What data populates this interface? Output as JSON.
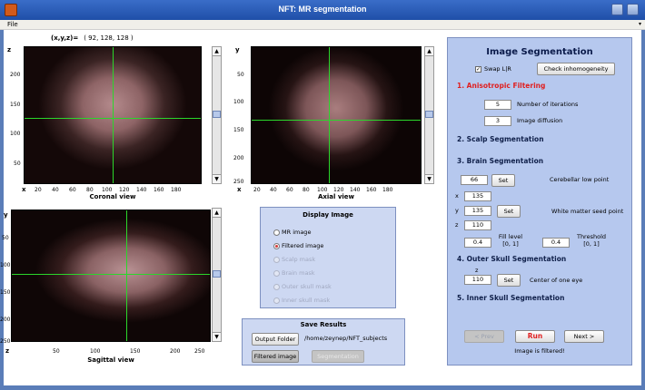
{
  "window": {
    "title": "NFT: MR segmentation"
  },
  "menu": {
    "file": "File"
  },
  "coords": {
    "label": "(x,y,z)=",
    "value": "( 92, 128, 128 )"
  },
  "coronal": {
    "xlabel": "x",
    "ylabel": "z",
    "title": "Coronal view",
    "xticks": [
      "20",
      "40",
      "60",
      "80",
      "100",
      "120",
      "140",
      "160",
      "180"
    ],
    "yticks": [
      "200",
      "150",
      "100",
      "50"
    ]
  },
  "axial": {
    "xlabel": "x",
    "ylabel": "y",
    "title": "Axial view",
    "xticks": [
      "20",
      "40",
      "60",
      "80",
      "100",
      "120",
      "140",
      "160",
      "180"
    ],
    "yticks": [
      "50",
      "100",
      "150",
      "200",
      "250"
    ]
  },
  "sagittal": {
    "xlabel": "z",
    "ylabel": "y",
    "title": "Sagittal view",
    "xticks": [
      "50",
      "100",
      "150",
      "200",
      "250"
    ],
    "yticks": [
      "50",
      "100",
      "150",
      "200",
      "250"
    ]
  },
  "display_image": {
    "title": "Display Image",
    "options": [
      "MR image",
      "Filtered image",
      "Scalp mask",
      "Brain mask",
      "Outer skull mask",
      "Inner skull mask"
    ],
    "selected": "Filtered image"
  },
  "save_results": {
    "title": "Save Results",
    "output_folder_label": "Output Folder",
    "path": "/home/zeynep/NFT_subjects",
    "filtered_image_label": "Filtered image",
    "segmentation_label": "Segmentation"
  },
  "segmentation": {
    "title": "Image Segmentation",
    "swap_label": "Swap L|R",
    "check_inhomogeneity_label": "Check inhomogeneity",
    "s1": "1. Anisotropic Filtering",
    "iterations_value": "5",
    "iterations_label": "Number of iterations",
    "diffusion_value": "3",
    "diffusion_label": "Image diffusion",
    "s2": "2. Scalp Segmentation",
    "s3": "3. Brain Segmentation",
    "cerebellar_value": "66",
    "set_label": "Set",
    "cerebellar_label": "Cerebellar low point",
    "seed_x_label": "x",
    "seed_x_value": "135",
    "seed_y_label": "y",
    "seed_y_value": "135",
    "seed_z_label": "z",
    "seed_z_value": "110",
    "seed_label": "White matter seed point",
    "fill_value": "0.4",
    "fill_label": "Fill level",
    "fill_range": "[0, 1]",
    "threshold_value": "0.4",
    "threshold_label": "Threshold",
    "threshold_range": "[0, 1]",
    "s4": "4. Outer Skull Segmentation",
    "eye_z_label": "z",
    "eye_value": "110",
    "eye_label": "Center of one eye",
    "s5": "5. Inner Skull Segmentation",
    "prev_label": "< Prev",
    "run_label": "Run",
    "next_label": "Next >",
    "status": "Image is filtered!"
  }
}
